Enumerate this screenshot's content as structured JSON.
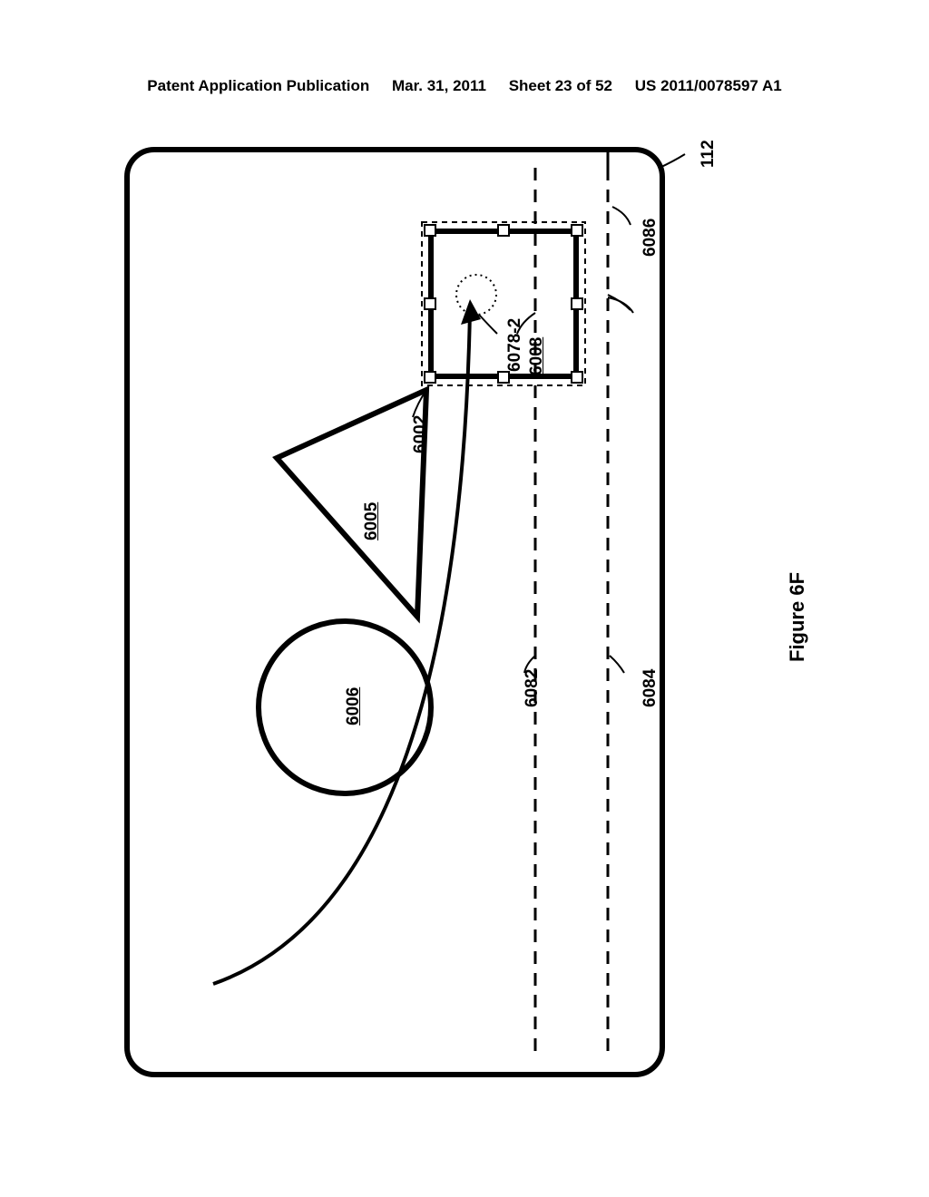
{
  "header": {
    "left": "Patent Application Publication",
    "date": "Mar. 31, 2011",
    "sheet": "Sheet 23 of 52",
    "pubno": "US 2011/0078597 A1"
  },
  "labels": {
    "ref_112": "112",
    "ref_6086": "6086",
    "ref_6084": "6084",
    "ref_6082": "6082",
    "ref_6008": "6008",
    "ref_6078_2": "6078-2",
    "ref_6002": "6002",
    "ref_6005": "6005",
    "ref_6006": "6006"
  },
  "figure_caption": "Figure 6F"
}
